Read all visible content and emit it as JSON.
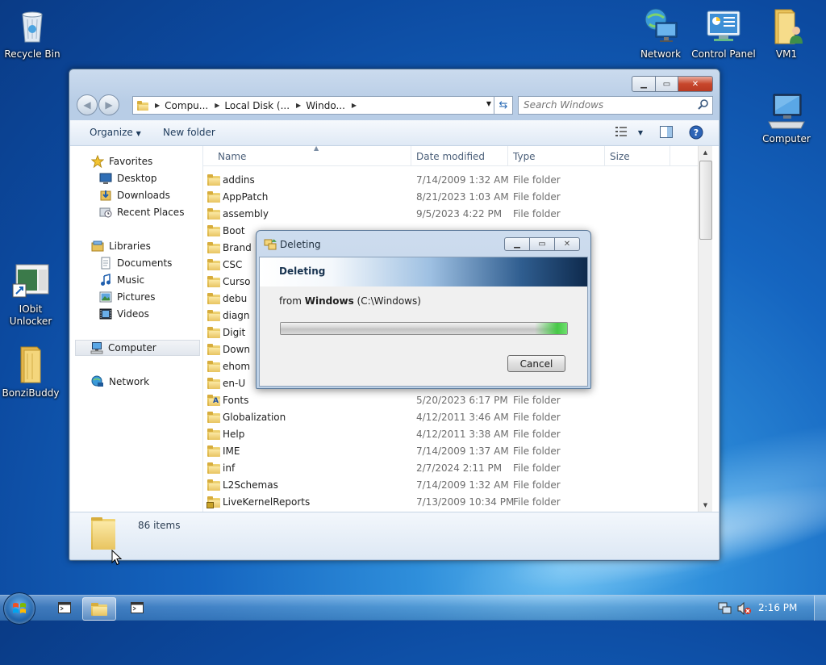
{
  "desktop": {
    "icons": [
      {
        "label": "Recycle Bin"
      },
      {
        "label": "Network"
      },
      {
        "label": "Control Panel"
      },
      {
        "label": "VM1"
      },
      {
        "label": "Computer"
      },
      {
        "label": "IObit Unlocker"
      },
      {
        "label": "BonziBuddy"
      }
    ]
  },
  "explorer": {
    "address": {
      "segments": [
        "Compu...",
        "Local Disk (...",
        "Windo..."
      ]
    },
    "search": {
      "placeholder": "Search Windows"
    },
    "toolbar": {
      "organize": "Organize",
      "new_folder": "New folder"
    },
    "nav": {
      "favorites": "Favorites",
      "desktop": "Desktop",
      "downloads": "Downloads",
      "recent_places": "Recent Places",
      "libraries": "Libraries",
      "documents": "Documents",
      "music": "Music",
      "pictures": "Pictures",
      "videos": "Videos",
      "computer": "Computer",
      "network": "Network"
    },
    "columns": {
      "name": "Name",
      "date": "Date modified",
      "type": "Type",
      "size": "Size"
    },
    "rows": [
      {
        "name": "addins",
        "date": "7/14/2009 1:32 AM",
        "type": "File folder"
      },
      {
        "name": "AppPatch",
        "date": "8/21/2023 1:03 AM",
        "type": "File folder"
      },
      {
        "name": "assembly",
        "date": "9/5/2023 4:22 PM",
        "type": "File folder"
      },
      {
        "name": "Boot",
        "date": "",
        "type": ""
      },
      {
        "name": "Brand",
        "date": "",
        "type": ""
      },
      {
        "name": "CSC",
        "date": "",
        "type": ""
      },
      {
        "name": "Curso",
        "date": "",
        "type": ""
      },
      {
        "name": "debu",
        "date": "",
        "type": ""
      },
      {
        "name": "diagn",
        "date": "",
        "type": ""
      },
      {
        "name": "Digit",
        "date": "",
        "type": ""
      },
      {
        "name": "Down",
        "date": "",
        "type": ""
      },
      {
        "name": "ehom",
        "date": "",
        "type": ""
      },
      {
        "name": "en-U",
        "date": "",
        "type": ""
      },
      {
        "name": "Fonts",
        "date": "5/20/2023 6:17 PM",
        "type": "File folder"
      },
      {
        "name": "Globalization",
        "date": "4/12/2011 3:46 AM",
        "type": "File folder"
      },
      {
        "name": "Help",
        "date": "4/12/2011 3:38 AM",
        "type": "File folder"
      },
      {
        "name": "IME",
        "date": "7/14/2009 1:37 AM",
        "type": "File folder"
      },
      {
        "name": "inf",
        "date": "2/7/2024 2:11 PM",
        "type": "File folder"
      },
      {
        "name": "L2Schemas",
        "date": "7/14/2009 1:32 AM",
        "type": "File folder"
      },
      {
        "name": "LiveKernelReports",
        "date": "7/13/2009 10:34 PM",
        "type": "File folder"
      }
    ],
    "status": {
      "items": "86 items"
    }
  },
  "dialog": {
    "title": "Deleting",
    "header": "Deleting",
    "from_prefix": "from ",
    "from_name": "Windows",
    "from_path": " (C:\\Windows)",
    "progress": 1.0,
    "cancel": "Cancel"
  },
  "taskbar": {
    "clock": "2:16 PM"
  },
  "colors": {
    "accent": "#1565c0",
    "close": "#c7462c",
    "progress_green": "#46c846"
  }
}
